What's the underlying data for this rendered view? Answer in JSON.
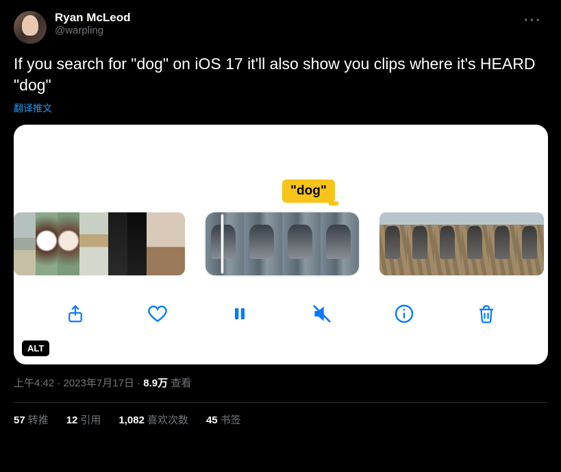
{
  "author": {
    "name": "Ryan McLeod",
    "handle": "@warpling"
  },
  "body_text": "If you search for \"dog\" on iOS 17 it'll also show you clips where it's HEARD \"dog\"",
  "translate_label": "翻译推文",
  "media": {
    "search_token": "\"dog\"",
    "alt_badge": "ALT"
  },
  "meta": {
    "time": "上午4:42",
    "date": "2023年7月17日",
    "views_count": "8.9万",
    "views_label": "查看",
    "separator": " · "
  },
  "stats": {
    "retweets": {
      "count": "57",
      "label": "转推"
    },
    "quotes": {
      "count": "12",
      "label": "引用"
    },
    "likes": {
      "count": "1,082",
      "label": "喜欢次数"
    },
    "bookmarks": {
      "count": "45",
      "label": "书签"
    }
  }
}
